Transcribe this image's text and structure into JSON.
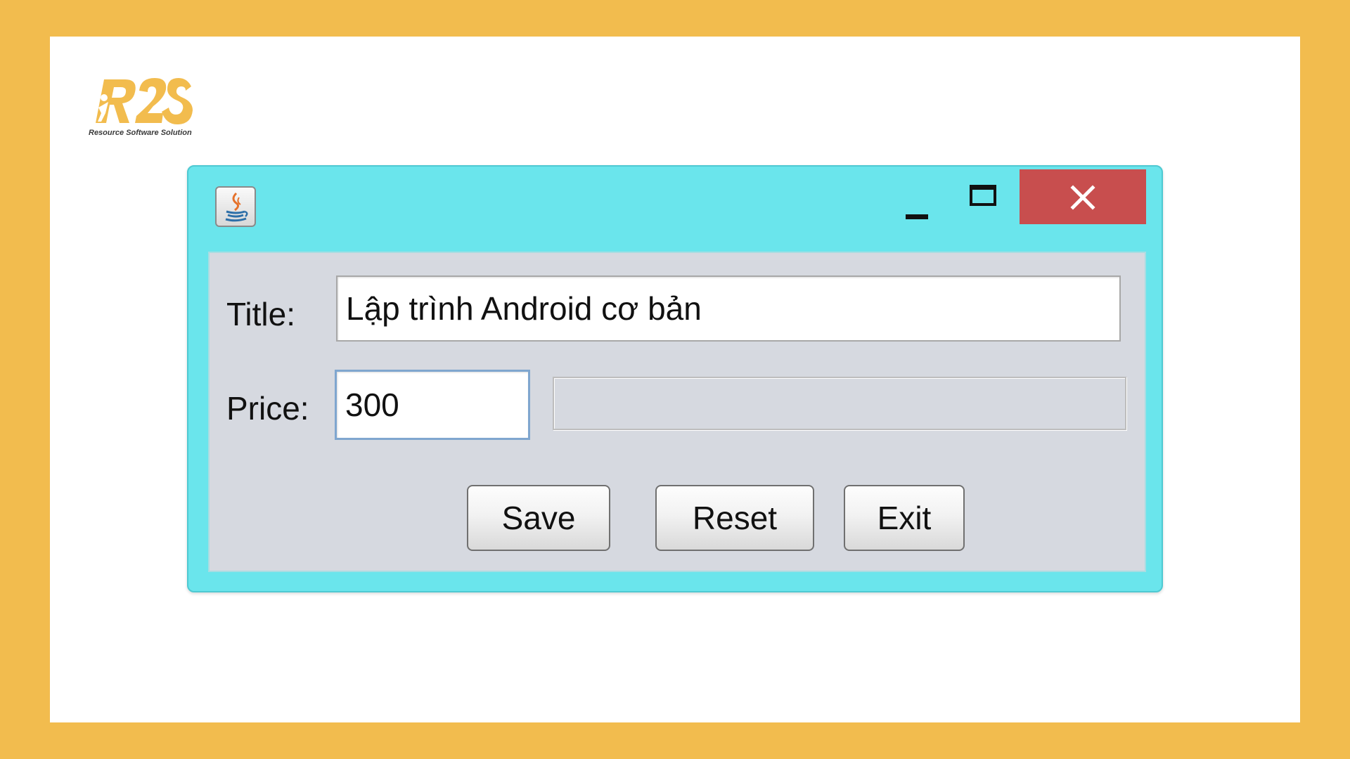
{
  "logo": {
    "mark": "R2S",
    "tagline": "Resource Software Solution"
  },
  "window": {
    "icon": "java-icon",
    "controls": {
      "minimize": "minimize-icon",
      "maximize": "maximize-icon",
      "close": "close-icon"
    }
  },
  "form": {
    "title_label": "Title:",
    "title_value": "Lập trình Android cơ bản",
    "price_label": "Price:",
    "price_value": "300",
    "message_value": ""
  },
  "buttons": {
    "save": "Save",
    "reset": "Reset",
    "exit": "Exit"
  },
  "colors": {
    "background": "#F2BC4E",
    "window_frame": "#6AE5EC",
    "close_button": "#C84E4E",
    "panel": "#D6D9E0",
    "logo": "#F2BC4E"
  }
}
